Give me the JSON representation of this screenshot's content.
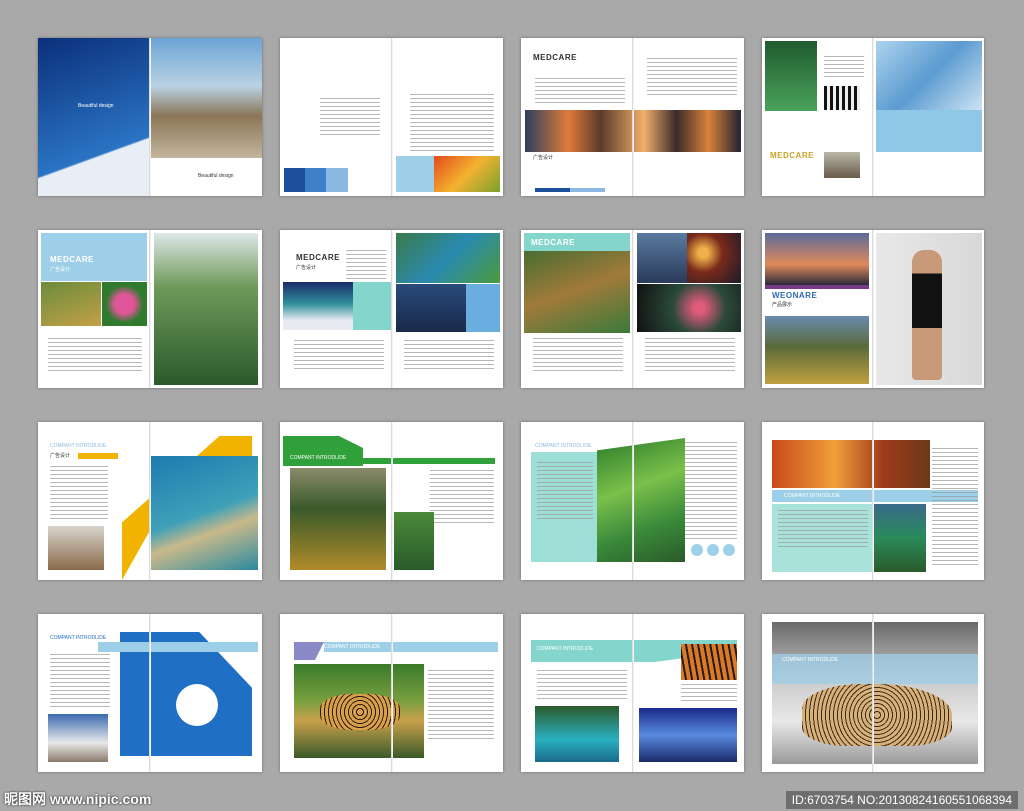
{
  "brochure": {
    "cover_logo_text": "Beautiful design",
    "cover_sub": "Beautiful design",
    "labels": {
      "medcare_1": "MEDCARE",
      "medcare_2": "MEDCARE",
      "medcare_3": "MEDCARE",
      "medcare_4": "MEDCARE",
      "medcare_5": "MEDCARE",
      "weonare": "WEONARE",
      "compant_1": "COMPANT INTRODLIDE",
      "compant_2": "COMPANT INTRODLIDE",
      "compant_3": "COMPANT INTRODLIDE",
      "compant_4": "COMPANT INTRODLIDE",
      "compant_5": "COMPANT INTRODLIDE",
      "compant_6": "COMPANT INTRODLIDE",
      "compant_7": "COMPANT INTRODLIDE",
      "compant_8": "COMPANT INTRODLIDE",
      "ad_design_1": "广告设计",
      "ad_design_2": "广告设计",
      "ad_design_3": "广告设计",
      "ad_design_4": "广告设计",
      "product_show": "产品展示"
    }
  },
  "watermark": {
    "left": "昵图网 www.nipic.com",
    "right": "ID:6703754 NO:20130824160551068394"
  },
  "colors": {
    "background": "#a9a9a9",
    "blue": "#1f6fc4",
    "light_blue": "#9ecfe8",
    "yellow": "#f2b300",
    "green": "#2fa03a",
    "teal": "#84d6cc"
  }
}
